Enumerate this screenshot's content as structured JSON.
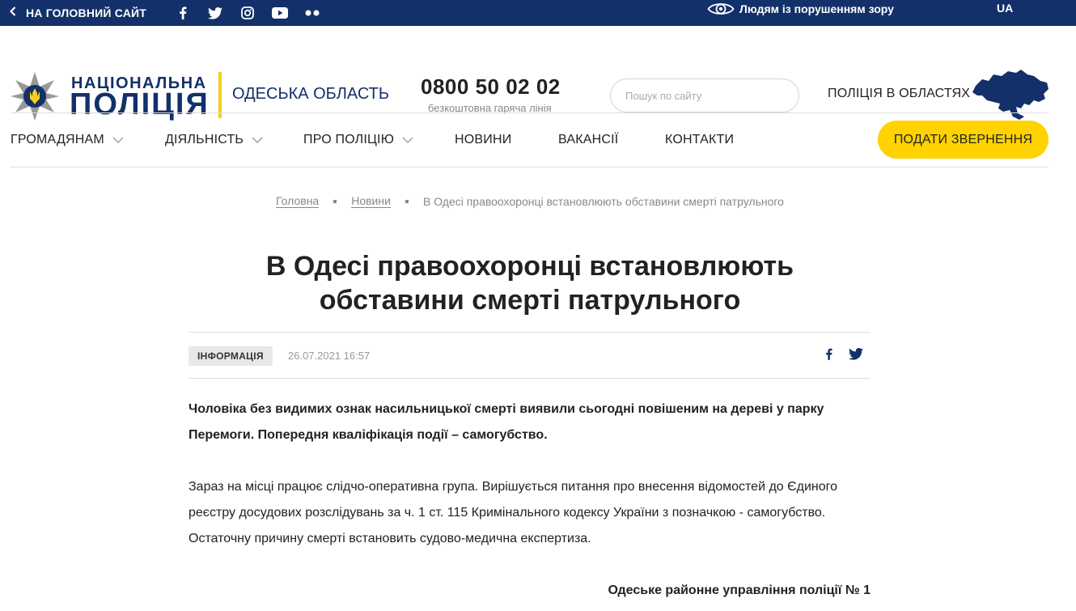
{
  "topbar": {
    "back_label": "НА ГОЛОВНИЙ САЙТ",
    "socials": [
      "facebook-icon",
      "twitter-icon",
      "instagram-icon",
      "youtube-icon",
      "flickr-icon"
    ],
    "accessibility_label": "Людям із порушенням зору",
    "lang": "UA"
  },
  "header": {
    "logo_line1": "НАЦІОНАЛЬНА",
    "logo_line2": "ПОЛІЦІЯ",
    "region": "ОДЕСЬКА ОБЛАСТЬ",
    "phone": "0800 50 02 02",
    "phone_sub": "безкоштовна гаряча лінія",
    "search_placeholder": "Пошук по сайту",
    "regions_link": "ПОЛІЦІЯ В ОБЛАСТЯХ"
  },
  "nav": {
    "items": [
      {
        "label": "ГРОМАДЯНАМ"
      },
      {
        "label": "ДІЯЛЬНІСТЬ"
      },
      {
        "label": "ПРО ПОЛІЦІЮ"
      },
      {
        "label": "НОВИНИ"
      },
      {
        "label": "ВАКАНСІЇ"
      },
      {
        "label": "КОНТАКТИ"
      }
    ],
    "cta": "ПОДАТИ ЗВЕРНЕННЯ"
  },
  "breadcrumb": {
    "home": "Головна",
    "news": "Новини",
    "current": "В Одесі правоохоронці встановлюють обставини смерті патрульного"
  },
  "article": {
    "title_line1": "В Одесі правоохоронці встановлюють",
    "title_line2": "обставини смерті патрульного",
    "tag": "ІНФОРМАЦІЯ",
    "date": "26.07.2021 16:57",
    "lead": "Чоловіка  без видимих ознак насильницької смерті виявили сьогодні повішеним на дереві у парку Перемоги. Попередня кваліфікація події – самогубство.",
    "body": "Зараз на місці працює слідчо-оперативна група. Вирішується питання про внесення відомостей до Єдиного реєстру досудових розслідувань за ч. 1 ст. 115 Кримінального кодексу України з позначкою - самогубство. Остаточну причину смерті встановить судово-медична  експертиза.",
    "signature": "Одеське районне управління поліції № 1"
  },
  "colors": {
    "navy": "#13306a",
    "yellow": "#ffd200",
    "accent_divider": "#f5cf1b"
  }
}
